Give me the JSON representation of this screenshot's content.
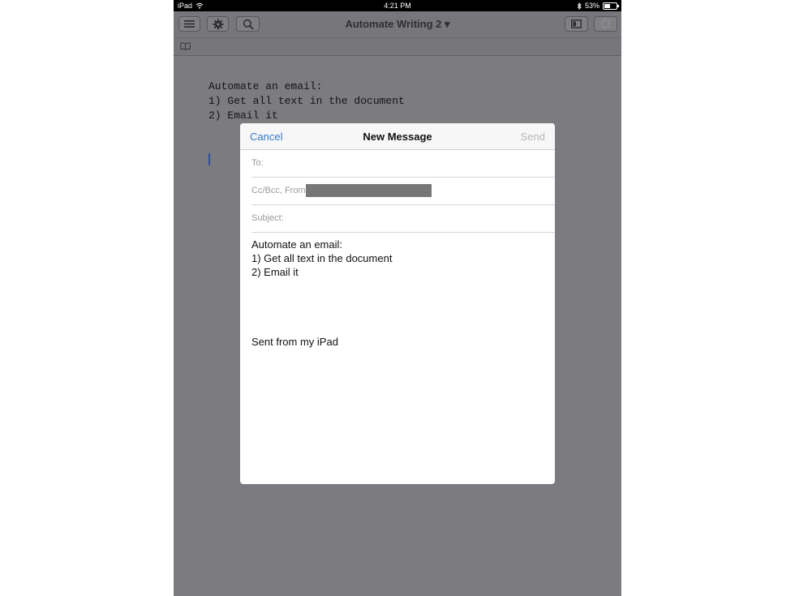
{
  "status_bar": {
    "device": "iPad",
    "time": "4:21 PM",
    "battery_percent": "53%",
    "battery_level": 0.53
  },
  "toolbar": {
    "document_title": "Automate Writing 2 ▾",
    "icons": [
      "menu-icon",
      "gear-icon",
      "search-icon",
      "sidebar-icon",
      "sync-spinner-icon"
    ]
  },
  "document": {
    "lines": [
      "Automate an email:",
      "",
      "1) Get all text in the document",
      "2) Email it"
    ]
  },
  "compose": {
    "cancel_label": "Cancel",
    "title": "New Message",
    "send_label": "Send",
    "to_label": "To:",
    "ccbcc_label": "Cc/Bcc, From:",
    "subject_label": "Subject:",
    "body_lines": [
      "Automate an email:",
      "",
      "1) Get all text in the document",
      "2) Email it"
    ],
    "signature": "Sent from my iPad"
  },
  "colors": {
    "accent": "#3478c6",
    "disabled": "#b7b7b7"
  }
}
